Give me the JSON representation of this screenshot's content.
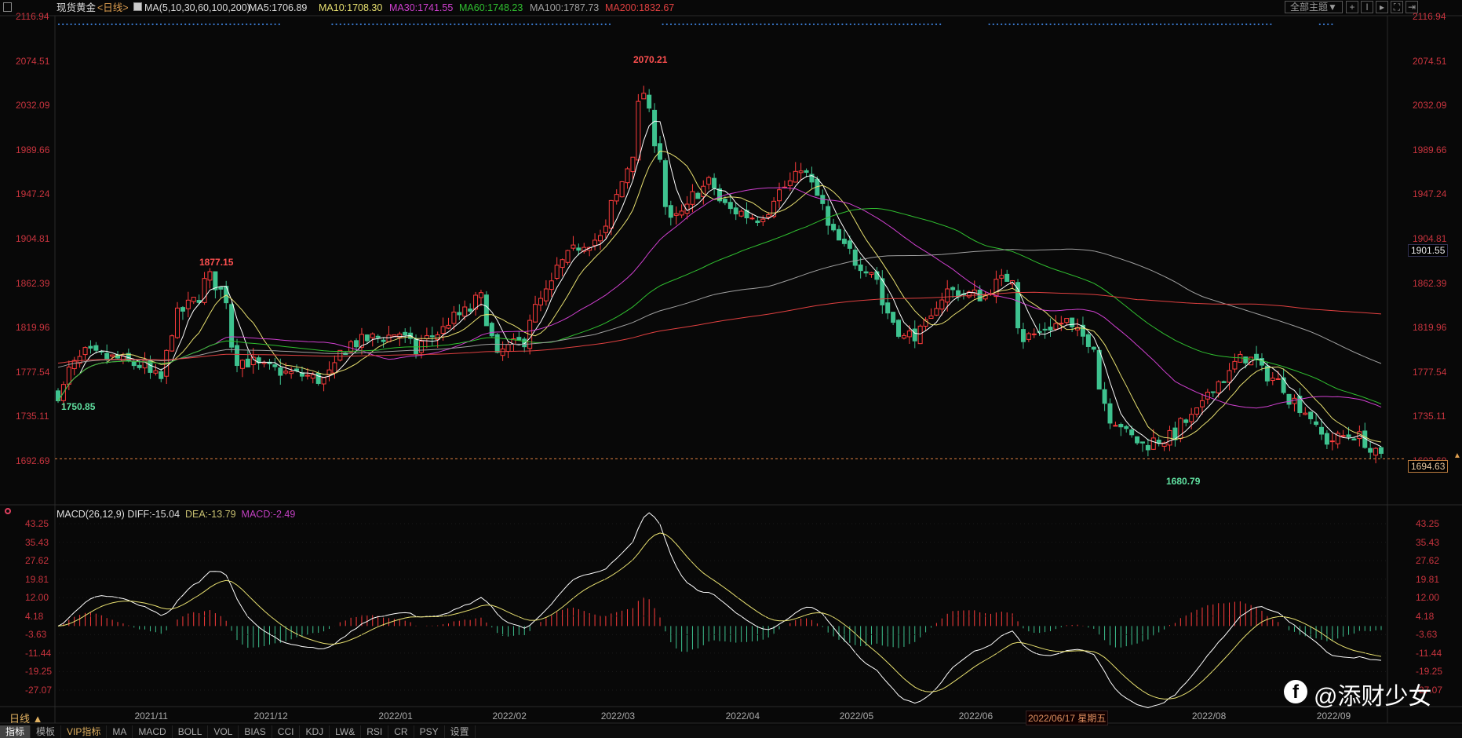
{
  "header": {
    "title": "现货黄金",
    "period_tag": "<日线>",
    "ma_params": "MA(5,10,30,60,100,200)",
    "ma5": "MA5:1706.89",
    "ma10": "MA10:1708.30",
    "ma30": "MA30:1741.55",
    "ma60": "MA60:1748.23",
    "ma100": "MA100:1787.73",
    "ma200": "MA200:1832.67"
  },
  "toolbar": {
    "theme_label": "全部主题▼",
    "icons": [
      "crosshair-icon",
      "zoom-range-icon",
      "play-icon",
      "fullscreen-icon",
      "exit-icon"
    ]
  },
  "colors": {
    "up": "#ff3c3c",
    "down": "#3ec28f",
    "ma5": "#ffffff",
    "ma10": "#e8e070",
    "ma30": "#d040d0",
    "ma60": "#30c030",
    "ma100": "#a0a0a0",
    "ma200": "#e04040",
    "axis": "#c8343e"
  },
  "price_axis": [
    "2116.94",
    "2074.51",
    "2032.09",
    "1989.66",
    "1947.24",
    "1904.81",
    "1862.39",
    "1819.96",
    "1777.54",
    "1735.11",
    "1692.69"
  ],
  "price_annotations": {
    "high": "2070.21",
    "nov_high": "1877.15",
    "start_low": "1750.85",
    "low": "1680.79"
  },
  "current_price": "1694.63",
  "crosshair_price": "1901.55",
  "macd": {
    "params": "MACD(26,12,9)",
    "diff": "DIFF:-15.04",
    "dea": "DEA:-13.79",
    "macd": "MACD:-2.49",
    "axis": [
      "43.25",
      "35.43",
      "27.62",
      "19.81",
      "12.00",
      "4.18",
      "-3.63",
      "-11.44",
      "-19.25",
      "-27.07"
    ]
  },
  "date_axis": {
    "period": "日线 ▲",
    "labels": [
      {
        "text": "2021/11",
        "date": "2021-11-01"
      },
      {
        "text": "2021/12",
        "date": "2021-12-01"
      },
      {
        "text": "2022/01",
        "date": "2022-01-03"
      },
      {
        "text": "2022/02",
        "date": "2022-02-01"
      },
      {
        "text": "2022/03",
        "date": "2022-03-01"
      },
      {
        "text": "2022/04",
        "date": "2022-04-01"
      },
      {
        "text": "2022/05",
        "date": "2022-05-02"
      },
      {
        "text": "2022/06",
        "date": "2022-06-01"
      },
      {
        "text": "2022/08",
        "date": "2022-08-01"
      },
      {
        "text": "2022/09",
        "date": "2022-09-01"
      }
    ],
    "crosshair_date": "2022/06/17 星期五"
  },
  "tabs": [
    "指标",
    "模板",
    "VIP指标",
    "MA",
    "MACD",
    "BOLL",
    "VOL",
    "BIAS",
    "CCI",
    "KDJ",
    "LW&",
    "RSI",
    "CR",
    "PSY",
    "设置"
  ],
  "watermark": "@添财少女",
  "chart_data": {
    "type": "candlestick",
    "ylim": [
      1692.69,
      2116.94
    ],
    "macd_ylim": [
      -27.07,
      43.25
    ],
    "close_keypoints": [
      [
        "2021-10-07",
        1757
      ],
      [
        "2021-10-14",
        1795
      ],
      [
        "2021-10-22",
        1790
      ],
      [
        "2021-10-29",
        1783
      ],
      [
        "2021-11-03",
        1770
      ],
      [
        "2021-11-05",
        1818
      ],
      [
        "2021-11-16",
        1868
      ],
      [
        "2021-11-19",
        1848
      ],
      [
        "2021-11-23",
        1790
      ],
      [
        "2021-12-01",
        1780
      ],
      [
        "2021-12-15",
        1770
      ],
      [
        "2021-12-22",
        1805
      ],
      [
        "2022-01-04",
        1815
      ],
      [
        "2022-01-07",
        1797
      ],
      [
        "2022-01-14",
        1818
      ],
      [
        "2022-01-25",
        1848
      ],
      [
        "2022-01-28",
        1790
      ],
      [
        "2022-02-04",
        1808
      ],
      [
        "2022-02-11",
        1860
      ],
      [
        "2022-02-18",
        1898
      ],
      [
        "2022-02-24",
        1905
      ],
      [
        "2022-03-01",
        1945
      ],
      [
        "2022-03-08",
        2045
      ],
      [
        "2022-03-10",
        2000
      ],
      [
        "2022-03-15",
        1920
      ],
      [
        "2022-03-24",
        1958
      ],
      [
        "2022-03-30",
        1932
      ],
      [
        "2022-04-06",
        1925
      ],
      [
        "2022-04-18",
        1975
      ],
      [
        "2022-04-22",
        1935
      ],
      [
        "2022-04-28",
        1895
      ],
      [
        "2022-05-05",
        1875
      ],
      [
        "2022-05-13",
        1810
      ],
      [
        "2022-05-18",
        1815
      ],
      [
        "2022-05-25",
        1855
      ],
      [
        "2022-06-03",
        1850
      ],
      [
        "2022-06-10",
        1870
      ],
      [
        "2022-06-14",
        1810
      ],
      [
        "2022-06-24",
        1826
      ],
      [
        "2022-07-01",
        1805
      ],
      [
        "2022-07-06",
        1735
      ],
      [
        "2022-07-14",
        1708
      ],
      [
        "2022-07-21",
        1715
      ],
      [
        "2022-07-27",
        1733
      ],
      [
        "2022-08-02",
        1765
      ],
      [
        "2022-08-10",
        1792
      ],
      [
        "2022-08-16",
        1775
      ],
      [
        "2022-08-23",
        1750
      ],
      [
        "2022-08-31",
        1712
      ],
      [
        "2022-09-07",
        1718
      ],
      [
        "2022-09-14",
        1695
      ]
    ]
  }
}
